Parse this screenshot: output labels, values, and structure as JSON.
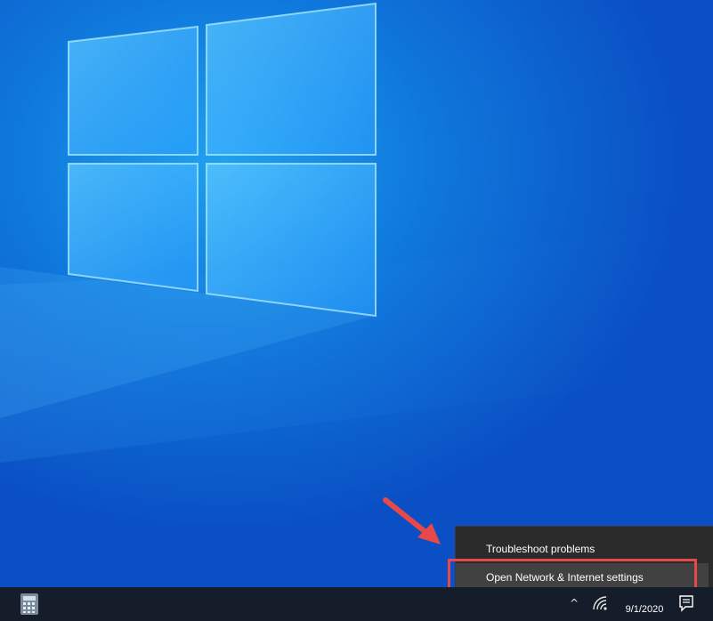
{
  "context_menu": {
    "items": [
      {
        "label": "Troubleshoot problems"
      },
      {
        "label": "Open Network & Internet settings"
      }
    ]
  },
  "taskbar": {
    "clock": {
      "date": "9/1/2020"
    },
    "tray_chevron": "^"
  },
  "colors": {
    "menu_bg": "#2b2b2b",
    "menu_hover": "#414141",
    "highlight": "#e84848",
    "taskbar_bg": "#151c2a"
  },
  "icons": {
    "taskbar_app": "calculator-icon",
    "tray_network": "wifi-icon",
    "notification": "action-center-icon"
  }
}
